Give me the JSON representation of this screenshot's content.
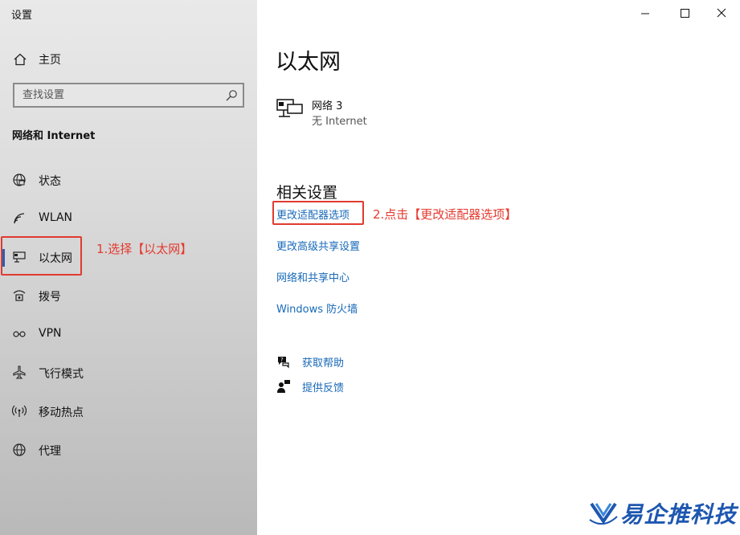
{
  "window": {
    "title": "设置",
    "controls": [
      "minimize",
      "maximize",
      "close"
    ]
  },
  "sidebar": {
    "home_label": "主页",
    "search_placeholder": "查找设置",
    "section_title": "网络和 Internet",
    "items": [
      {
        "label": "状态",
        "icon": "status-globe-icon"
      },
      {
        "label": "WLAN",
        "icon": "wifi-icon"
      },
      {
        "label": "以太网",
        "icon": "ethernet-icon",
        "active": true
      },
      {
        "label": "拨号",
        "icon": "dialup-icon"
      },
      {
        "label": "VPN",
        "icon": "vpn-icon"
      },
      {
        "label": "飞行模式",
        "icon": "airplane-icon"
      },
      {
        "label": "移动热点",
        "icon": "hotspot-icon"
      },
      {
        "label": "代理",
        "icon": "proxy-globe-icon"
      }
    ]
  },
  "main": {
    "title": "以太网",
    "network": {
      "name": "网络 3",
      "status": "无 Internet"
    },
    "related_title": "相关设置",
    "links": [
      "更改适配器选项",
      "更改高级共享设置",
      "网络和共享中心",
      "Windows 防火墙"
    ],
    "help": {
      "get_help": "获取帮助",
      "feedback": "提供反馈"
    }
  },
  "annotations": {
    "step1": "1.选择【以太网】",
    "step2": "2.点击【更改适配器选项】"
  },
  "watermark": {
    "text": "易企推科技"
  },
  "colors": {
    "link": "#1769b8",
    "annotation_red": "#e5392e",
    "active_indicator": "#2a5db0",
    "watermark_blue": "#1d57b0"
  }
}
